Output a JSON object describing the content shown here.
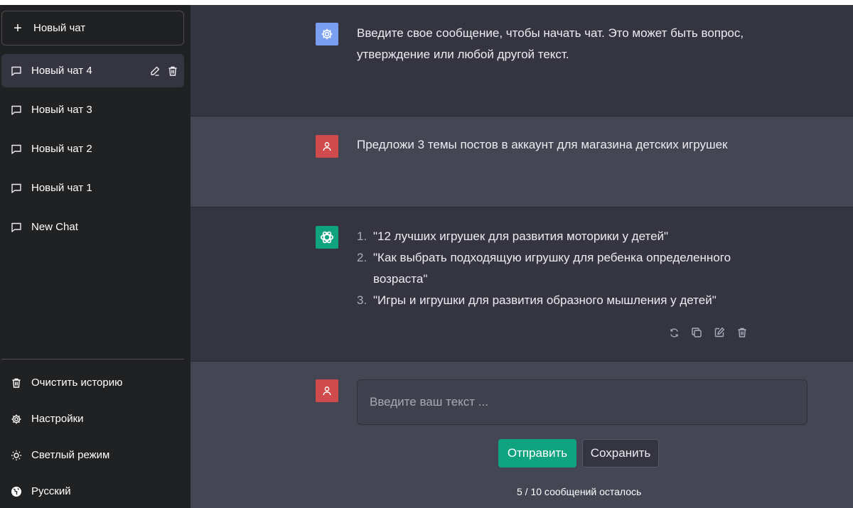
{
  "sidebar": {
    "new_chat_label": "Новый чат",
    "chats": [
      {
        "label": "Новый чат 4",
        "active": true
      },
      {
        "label": "Новый чат 3",
        "active": false
      },
      {
        "label": "Новый чат 2",
        "active": false
      },
      {
        "label": "Новый чат 1",
        "active": false
      },
      {
        "label": "New Chat",
        "active": false
      }
    ],
    "bottom_menu": [
      {
        "label": "Очистить историю",
        "icon": "trash-icon"
      },
      {
        "label": "Настройки",
        "icon": "gear-icon"
      },
      {
        "label": "Светлый режим",
        "icon": "sun-icon"
      },
      {
        "label": "Русский",
        "icon": "globe-icon"
      }
    ]
  },
  "conversation": {
    "system_message": "Введите свое сообщение, чтобы начать чат. Это может быть вопрос, утверждение или любой другой текст.",
    "user_message": "Предложи 3 темы постов в аккаунт для магазина детских игрушек",
    "assistant_items": [
      {
        "num": "1.",
        "text": "\"12 лучших игрушек для развития моторики у детей\""
      },
      {
        "num": "2.",
        "text": "\"Как выбрать подходящую игрушку для ребенка определенного возраста\""
      },
      {
        "num": "3.",
        "text": "\"Игры и игрушки для развития образного мышления у детей\""
      }
    ]
  },
  "composer": {
    "placeholder": "Введите ваш текст ...",
    "value": "",
    "send_label": "Отправить",
    "save_label": "Сохранить",
    "remaining_text": "5 / 10 сообщений осталось"
  },
  "colors": {
    "sidebar_bg": "#202123",
    "main_dark": "#343541",
    "main_light": "#444654",
    "accent": "#10a37f",
    "user_avatar": "#d04b4b",
    "system_avatar": "#7b9ff0"
  }
}
